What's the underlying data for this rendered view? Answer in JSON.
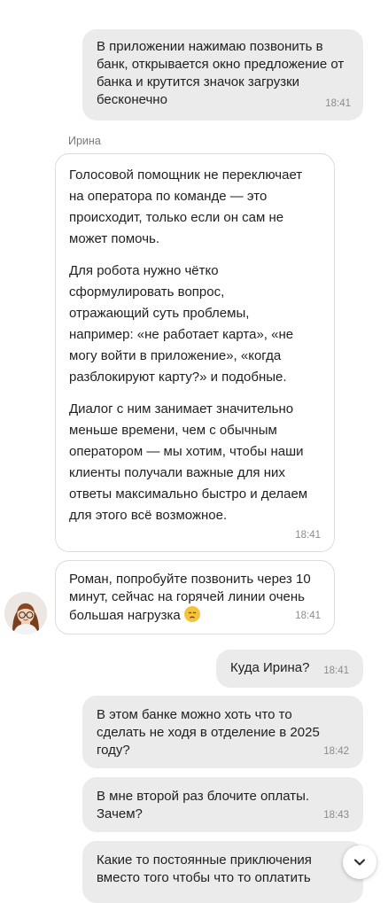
{
  "messages": {
    "m1": {
      "text": "В приложении нажимаю позвонить в банк, открывается окно предложение от банка и крутится значок загрузки бесконечно",
      "time": "18:41"
    },
    "sender_name": "Ирина",
    "m2": {
      "paragraphs": [
        "Голосовой помощник не переключает на оператора по команде — это происходит, только если он сам не может помочь.",
        "Для робота нужно чётко сформулировать вопрос, отражающий суть проблемы, например: «не работает карта», «не могу войти в приложение», «когда разблокируют карту?» и подобные.",
        "Диалог с ним занимает значительно меньше времени, чем с обычным оператором — мы хотим, чтобы наши клиенты получали важные для них ответы максимально быстро и делаем для этого всё возможное."
      ],
      "time": "18:41"
    },
    "m3": {
      "text": "Роман, попробуйте позвонить через 10 минут, сейчас на горячей линии очень большая нагрузка",
      "emoji": "disappointed-face",
      "time": "18:41"
    },
    "m4": {
      "text": "Куда Ирина?",
      "time": "18:41"
    },
    "m5": {
      "text": "В этом банке можно хоть что то сделать не ходя в отделение в 2025 году?",
      "time": "18:42"
    },
    "m6": {
      "text": "В мне второй раз блочите оплаты. Зачем?",
      "time": "18:43"
    },
    "m7": {
      "text": "Какие то постоянные приключения вместо того чтобы что то оплатить"
    }
  },
  "icons": {
    "avatar": "agent-avatar-woman",
    "scroll": "chevron-down-icon"
  },
  "colors": {
    "outgoing_bubble": "#ebebeb",
    "incoming_border": "#dcdcdc",
    "timestamp": "#8b8b8b"
  }
}
